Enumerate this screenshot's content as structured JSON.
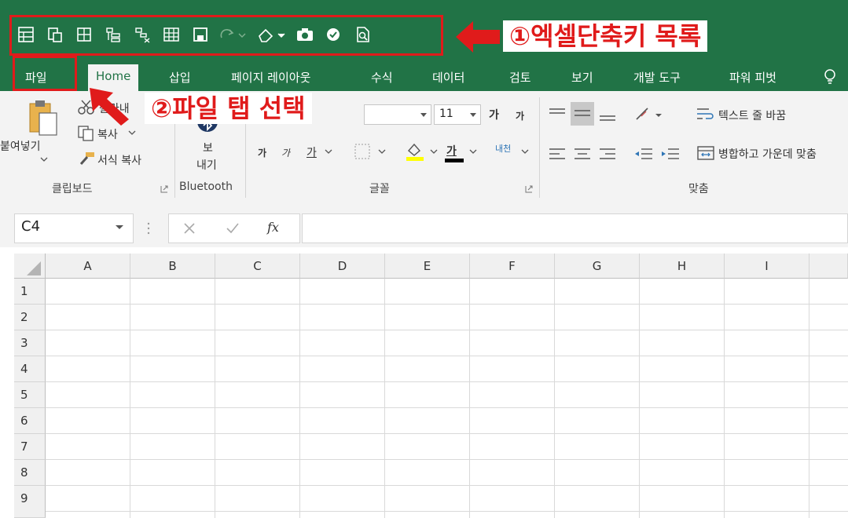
{
  "quick_access_toolbar": {
    "icons": [
      "form-icon",
      "paste-values-icon",
      "borders-icon",
      "group-icon",
      "ungroup-icon",
      "pivot-table-icon",
      "save-icon",
      "redo-icon",
      "clear-format-icon",
      "camera-icon",
      "macro-security-icon",
      "print-preview-icon"
    ]
  },
  "annotations": {
    "callout1": "①엑셀단축키 목록",
    "callout2": "②파일 탭 선택",
    "highlight_color": "#e01b1b"
  },
  "tabs": [
    "파일",
    "Home",
    "삽입",
    "페이지 레이아웃",
    "수식",
    "데이터",
    "검토",
    "보기",
    "개발 도구",
    "파워 피벗"
  ],
  "ribbon": {
    "clipboard": {
      "paste": "붙여넣기",
      "cut": "잘라내",
      "copy": "복사",
      "format_painter": "서식 복사",
      "group_label": "클립보드"
    },
    "bluetooth": {
      "send_line1": "보",
      "send_line2": "내기",
      "group_label": "Bluetooth"
    },
    "font": {
      "size": "11",
      "grow": "가",
      "shrink": "가",
      "bold": "가",
      "italic": "가",
      "underline": "가",
      "font_color": "가",
      "phonetic": "내천",
      "group_label": "글꼴"
    },
    "alignment": {
      "wrap_text": "텍스트 줄 바꿈",
      "merge_center": "병합하고 가운데 맞춤",
      "group_label": "맞춤"
    }
  },
  "formula_bar": {
    "name_box": "C4",
    "fx": "fx",
    "value": ""
  },
  "grid": {
    "columns": [
      "A",
      "B",
      "C",
      "D",
      "E",
      "F",
      "G",
      "H",
      "I"
    ],
    "rows": [
      "1",
      "2",
      "3",
      "4",
      "5",
      "6",
      "7",
      "8",
      "9"
    ]
  },
  "colors": {
    "excel_green": "#217346",
    "ribbon_bg": "#f3f3f3"
  }
}
